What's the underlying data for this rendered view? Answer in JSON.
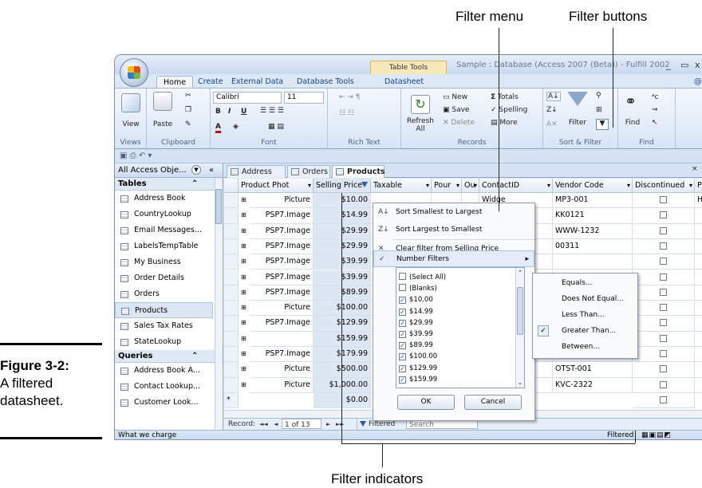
{
  "callouts": {
    "filter_menu": "Filter menu",
    "filter_buttons": "Filter buttons",
    "filter_indicators": "Filter indicators"
  },
  "caption": {
    "figure": "Figure 3-2:",
    "line1": "A filtered",
    "line2": "datasheet."
  },
  "window": {
    "context_tab": "Table Tools",
    "title": "Sample : Database (Access 2007 (Beta)) - Fulfill 2002",
    "min": "_",
    "max": "▭",
    "close": "x",
    "help": "@"
  },
  "ribbon_tabs": [
    "Home",
    "Create",
    "External Data",
    "Database Tools",
    "Datasheet"
  ],
  "ribbon": {
    "views": {
      "view": "View",
      "group": "Views"
    },
    "clipboard": {
      "paste": "Paste",
      "group": "Clipboard"
    },
    "font": {
      "name": "Calibri",
      "size": "11",
      "group": "Font",
      "bold": "B",
      "italic": "I",
      "underline": "U"
    },
    "rich_text": {
      "group": "Rich Text"
    },
    "records": {
      "refresh": "Refresh",
      "refresh2": "All",
      "new": "New",
      "save": "Save",
      "delete": "Delete",
      "totals": "Totals",
      "spelling": "Spelling",
      "more": "More",
      "group": "Records"
    },
    "sort_filter": {
      "filter": "Filter",
      "group": "Sort & Filter"
    },
    "find": {
      "find": "Find",
      "group": "Find"
    }
  },
  "nav": {
    "header": "All Access Obje...",
    "tables_label": "Tables",
    "tables": [
      "Address Book",
      "CountryLookup",
      "Email Messages...",
      "LabelsTempTable",
      "My Business",
      "Order Details",
      "Orders",
      "Products",
      "Sales Tax Rates",
      "StateLookup"
    ],
    "selected_table": "Products",
    "queries_label": "Queries",
    "queries": [
      "Address Book A...",
      "Contact Lookup...",
      "Customer Look..."
    ]
  },
  "doc_tabs": [
    "Address Book",
    "Orders",
    "Products"
  ],
  "columns": [
    "Product Phot",
    "Selling Price",
    "Taxable",
    "Pour",
    "Ou",
    "ContactID",
    "Vendor Code",
    "Discontinued",
    "Pr"
  ],
  "rows": [
    {
      "photo": "Picture",
      "price": "$10.00",
      "contact": "Widge",
      "vendor": "MP3-001",
      "pr": "Hy"
    },
    {
      "photo": "PSP7.Image",
      "price": "$14.99",
      "contact": "s Inc.",
      "vendor": "KK0121",
      "pr": ""
    },
    {
      "photo": "PSP7.Image",
      "price": "$29.99",
      "contact": "s Inc.",
      "vendor": "WWW-1232",
      "pr": ""
    },
    {
      "photo": "PSP7.Image",
      "price": "$29.99",
      "contact": "e Des",
      "vendor": "00311",
      "pr": ""
    },
    {
      "photo": "PSP7.Image",
      "price": "$39.99",
      "contact": "",
      "vendor": "",
      "pr": ""
    },
    {
      "photo": "PSP7.Image",
      "price": "$39.99",
      "contact": "",
      "vendor": "",
      "pr": ""
    },
    {
      "photo": "PSP7.Image",
      "price": "$89.99",
      "contact": "",
      "vendor": "",
      "pr": ""
    },
    {
      "photo": "Picture",
      "price": "$100.00",
      "contact": "",
      "vendor": "",
      "pr": ""
    },
    {
      "photo": "PSP7.Image",
      "price": "$129.99",
      "contact": "",
      "vendor": "",
      "pr": ""
    },
    {
      "photo": "",
      "price": "$159.99",
      "contact": "s Inc.",
      "vendor": "WWW-556",
      "pr": ""
    },
    {
      "photo": "PSP7.Image",
      "price": "$179.99",
      "contact": "e Des",
      "vendor": "KK-3232",
      "pr": ""
    },
    {
      "photo": "Picture",
      "price": "$500.00",
      "contact": "ry Sy:",
      "vendor": "OTST-001",
      "pr": ""
    },
    {
      "photo": "Picture",
      "price": "$1,000.00",
      "contact": "oduct",
      "vendor": "KVC-2322",
      "pr": ""
    }
  ],
  "new_row": {
    "marker": "*",
    "price": "$0.00"
  },
  "filter_menu": {
    "sort_asc": "Sort Smallest to Largest",
    "sort_desc": "Sort Largest to Smallest",
    "clear": "Clear filter from Selling Price",
    "number_filters": "Number Filters",
    "values": [
      {
        "label": "(Select All)",
        "checked": false
      },
      {
        "label": "(Blanks)",
        "checked": false
      },
      {
        "label": "$10.00",
        "checked": true
      },
      {
        "label": "$14.99",
        "checked": true
      },
      {
        "label": "$29.99",
        "checked": true
      },
      {
        "label": "$39.99",
        "checked": true
      },
      {
        "label": "$89.99",
        "checked": true
      },
      {
        "label": "$100.00",
        "checked": true
      },
      {
        "label": "$129.99",
        "checked": true
      },
      {
        "label": "$159.99",
        "checked": true
      }
    ],
    "ok": "OK",
    "cancel": "Cancel"
  },
  "number_submenu": [
    "Equals...",
    "Does Not Equal...",
    "Less Than...",
    "Greater Than...",
    "Between..."
  ],
  "record_nav": {
    "label": "Record:",
    "first": "◄◄",
    "prev": "◄",
    "position": "1 of 13",
    "next": "►",
    "last": "►►",
    "filtered": "Filtered",
    "search": "Search"
  },
  "statusbar": {
    "left": "What we charge",
    "right": "Filtered"
  }
}
